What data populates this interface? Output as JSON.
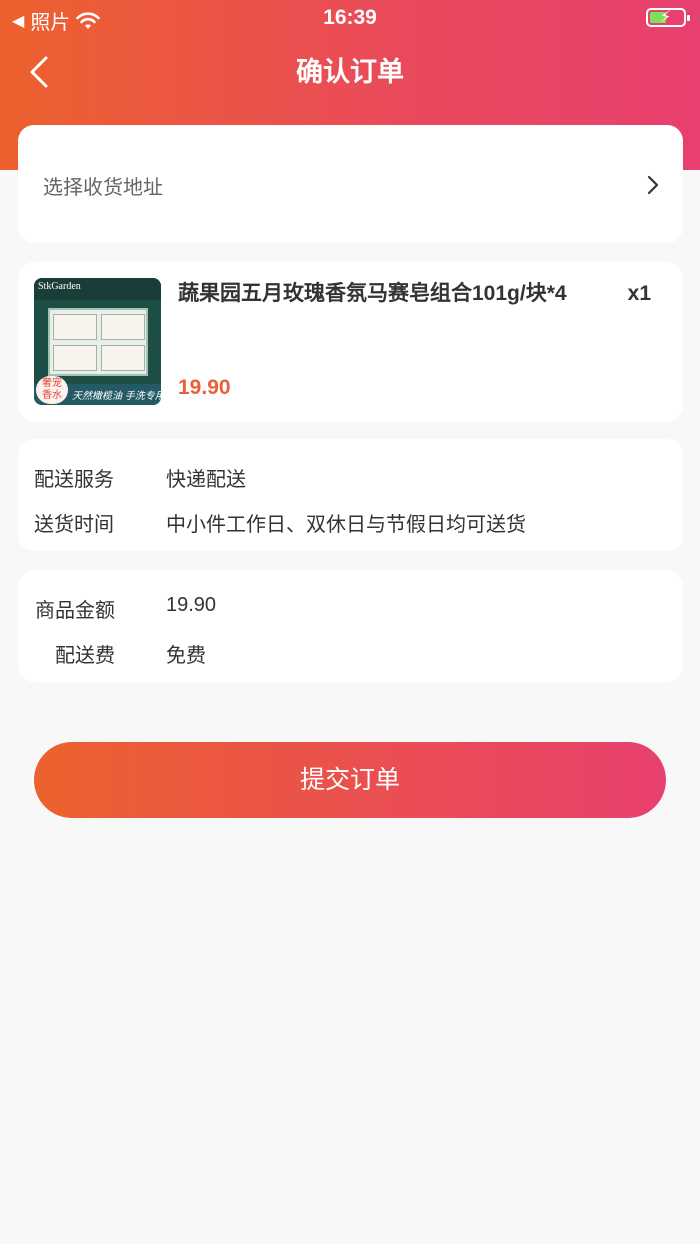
{
  "status_bar": {
    "back_app": "照片",
    "time": "16:39"
  },
  "nav": {
    "title": "确认订单"
  },
  "address": {
    "placeholder": "选择收货地址"
  },
  "product": {
    "name": "蔬果园五月玫瑰香氛马赛皂组合101g/块*4",
    "quantity": "x1",
    "price": "19.90",
    "image": {
      "brand": "StkGarden",
      "badge": "奢宠\n香水",
      "banner": "天然橄榄油 手洗专用"
    }
  },
  "delivery": {
    "service_label": "配送服务",
    "service_value": "快递配送",
    "time_label": "送货时间",
    "time_value": "中小件工作日、双休日与节假日均可送货"
  },
  "amount": {
    "goods_label": "商品金额",
    "goods_value": "19.90",
    "shipping_label": "配送费",
    "shipping_value": "免费"
  },
  "submit": {
    "label": "提交订单"
  },
  "colors": {
    "gradient_start": "#ec612d",
    "gradient_end": "#e8406f",
    "price": "#ea5f35",
    "background": "#f8f8f8"
  }
}
